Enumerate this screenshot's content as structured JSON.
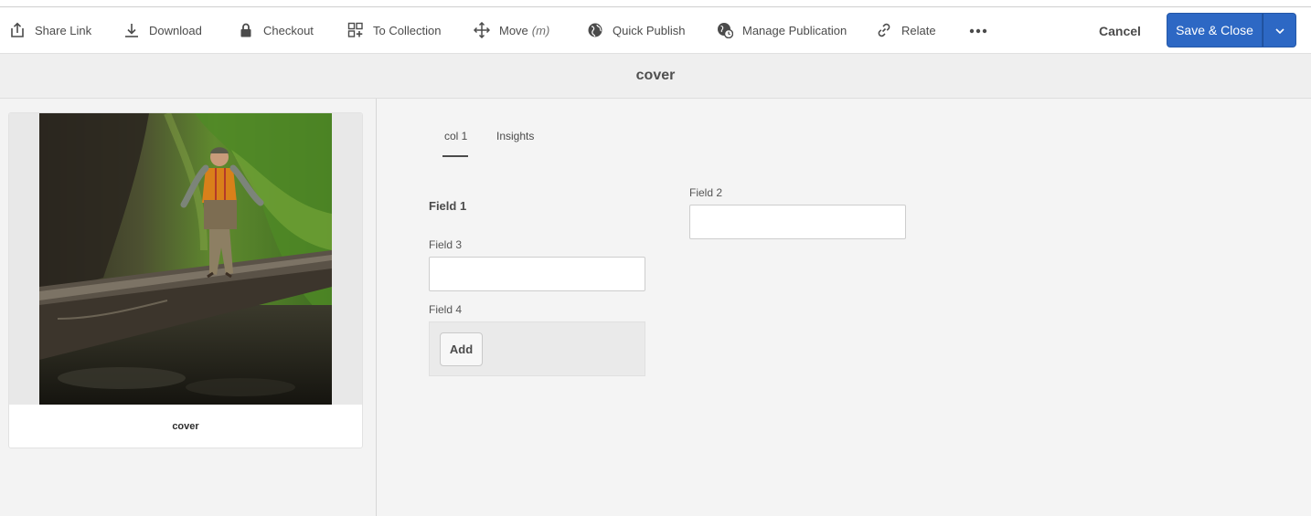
{
  "toolbar": {
    "items": [
      {
        "label": "Share Link",
        "icon": "share-icon"
      },
      {
        "label": "Download",
        "icon": "download-icon"
      },
      {
        "label": "Checkout",
        "icon": "lock-icon"
      },
      {
        "label": "To Collection",
        "icon": "collection-add-icon"
      },
      {
        "label": "Move",
        "shortcut": "(m)",
        "icon": "move-icon"
      },
      {
        "label": "Quick Publish",
        "icon": "globe-icon"
      },
      {
        "label": "Manage Publication",
        "icon": "globe-clock-icon"
      },
      {
        "label": "Relate",
        "icon": "link-icon"
      }
    ],
    "more_icon": "more-icon",
    "cancel_label": "Cancel",
    "save_label": "Save & Close",
    "save_dropdown_icon": "chevron-down-icon"
  },
  "page": {
    "title": "cover"
  },
  "asset_card": {
    "title": "cover"
  },
  "tabs": [
    {
      "label": "col 1",
      "selected": true
    },
    {
      "label": "Insights",
      "selected": false
    }
  ],
  "form": {
    "field1_heading": "Field 1",
    "field2_label": "Field 2",
    "field2_value": "",
    "field3_label": "Field 3",
    "field3_value": "",
    "field4_label": "Field 4",
    "add_label": "Add"
  },
  "colors": {
    "accent": "#2d68c4",
    "background": "#f4f4f4"
  }
}
